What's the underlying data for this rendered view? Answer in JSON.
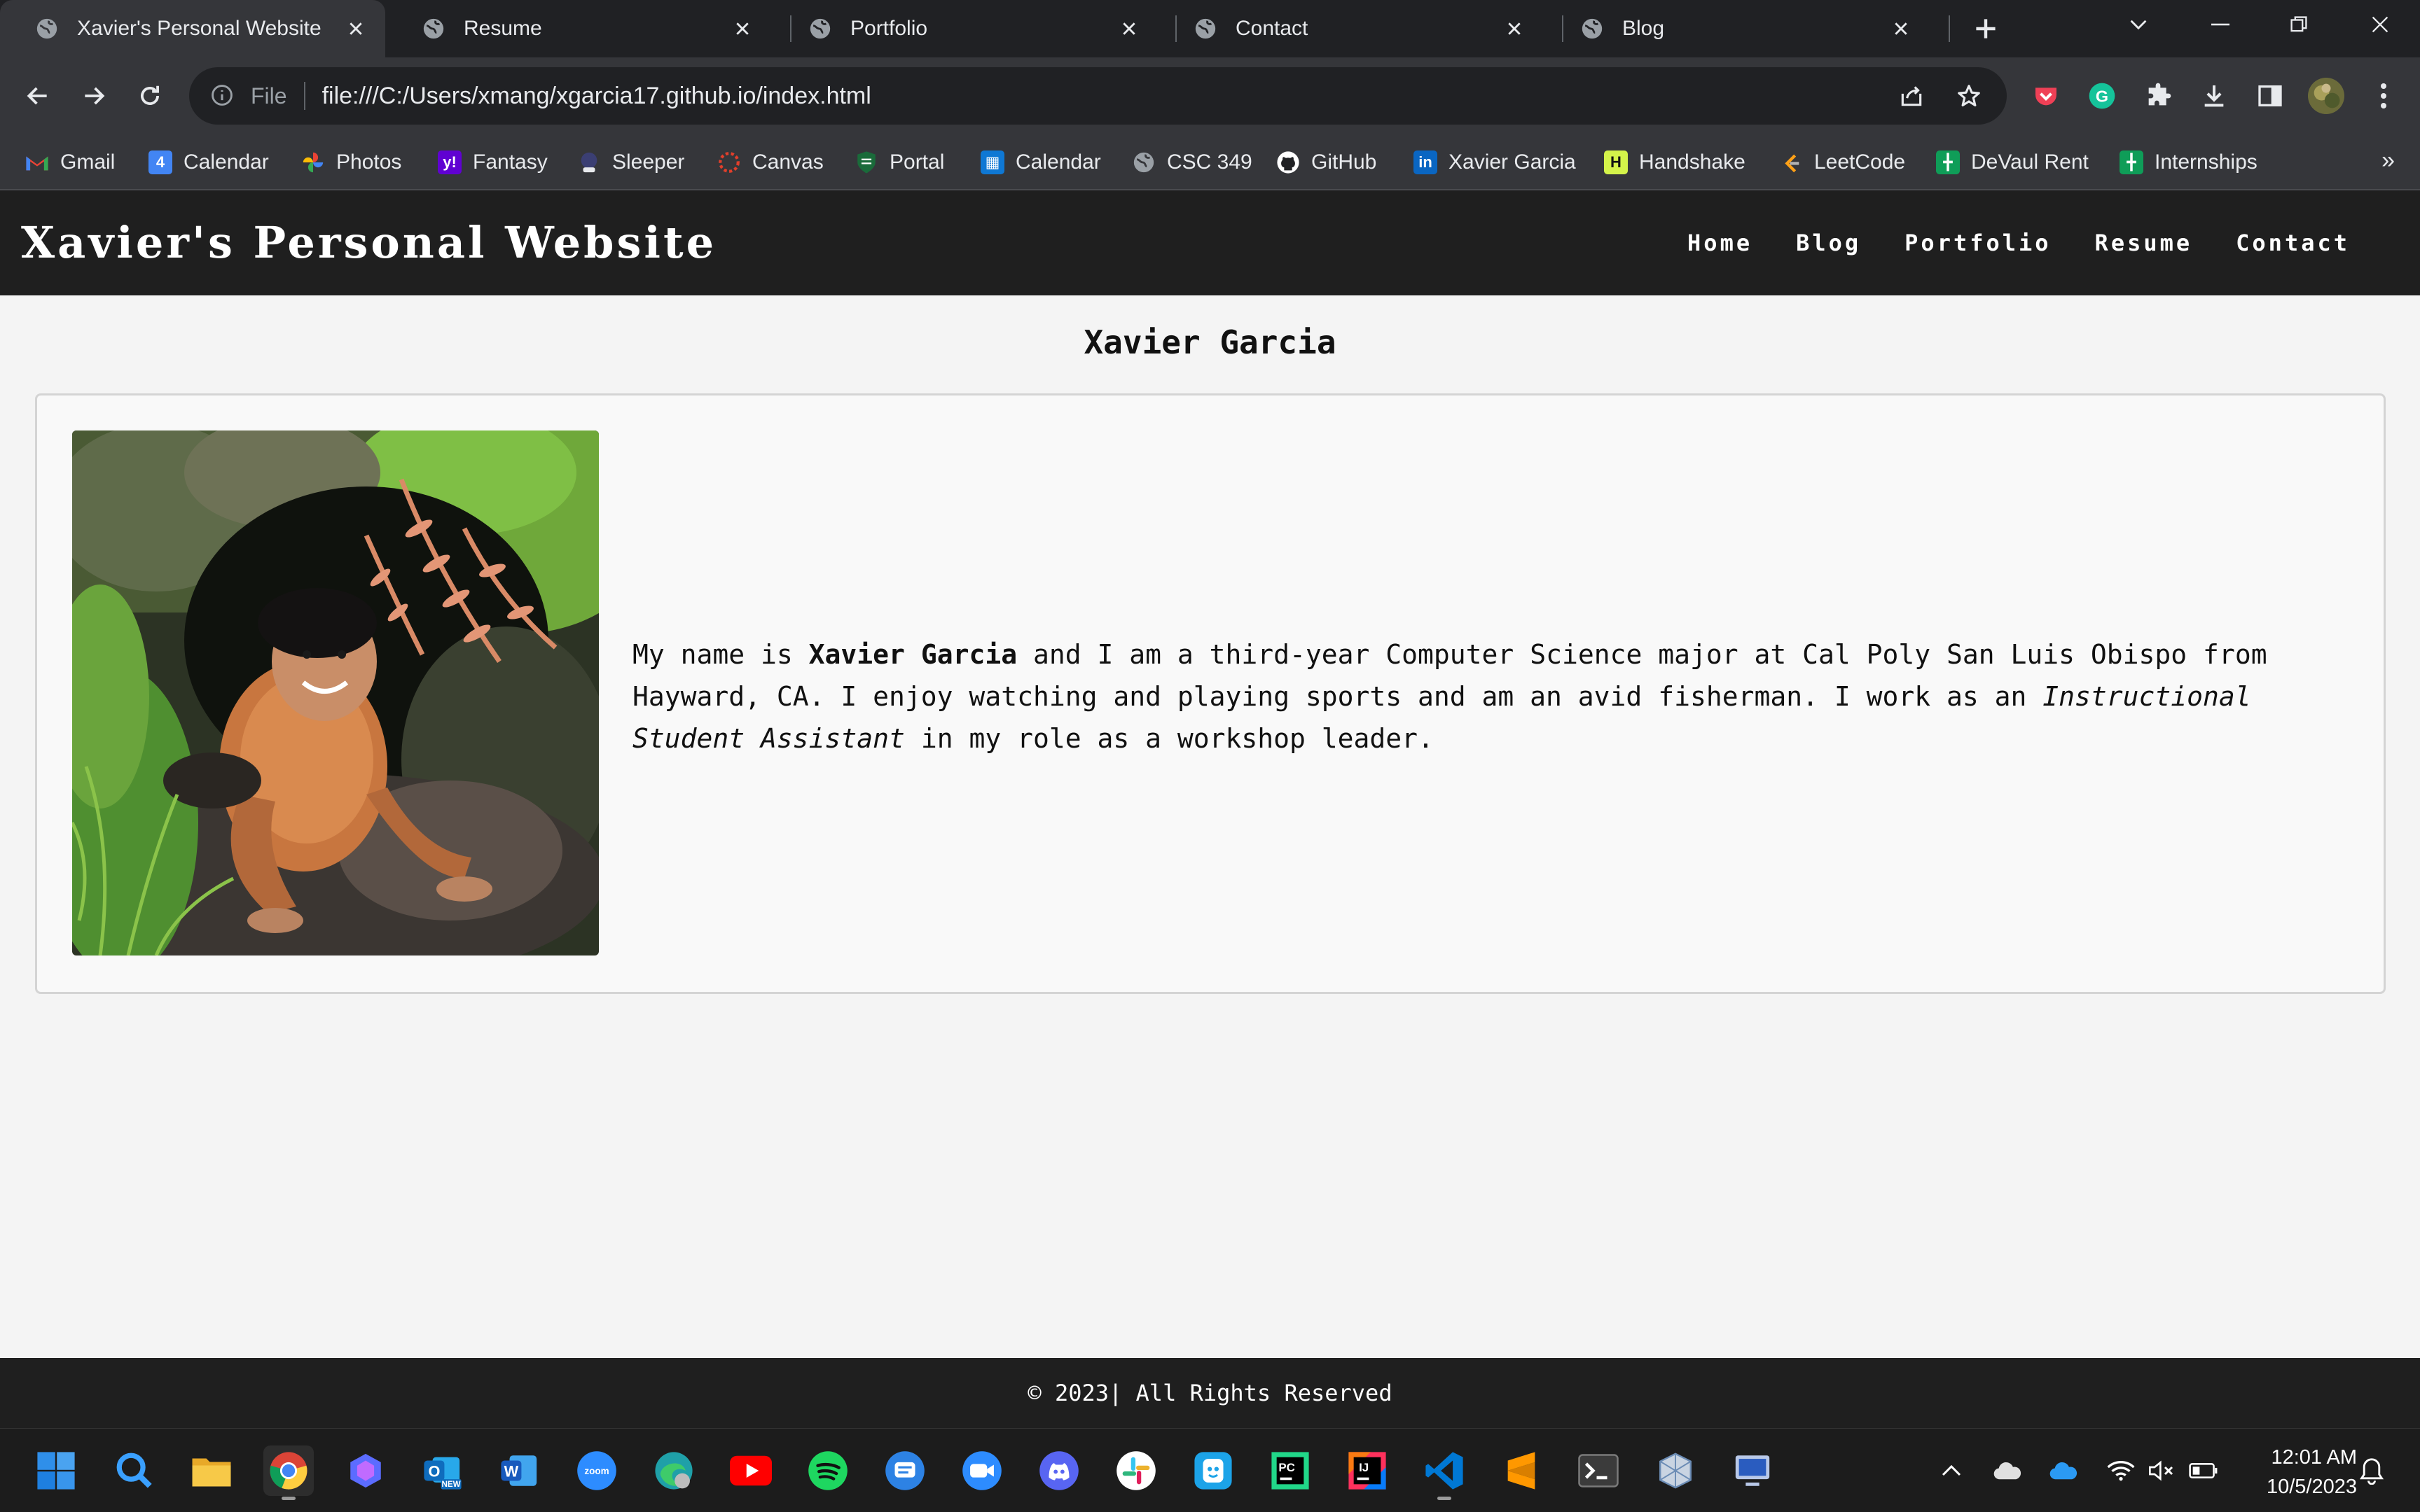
{
  "browser": {
    "tabs": [
      {
        "title": "Xavier's Personal Website",
        "active": true
      },
      {
        "title": "Resume",
        "active": false
      },
      {
        "title": "Portfolio",
        "active": false
      },
      {
        "title": "Contact",
        "active": false
      },
      {
        "title": "Blog",
        "active": false
      }
    ],
    "address": {
      "scheme_label": "File",
      "url": "file:///C:/Users/xmang/xgarcia17.github.io/index.html"
    },
    "bookmarks": [
      {
        "label": "Gmail",
        "icon": "gmail-icon",
        "color": "#ea4335"
      },
      {
        "label": "Calendar",
        "icon": "google-calendar-icon",
        "color": "#4285f4"
      },
      {
        "label": "Photos",
        "icon": "google-photos-icon",
        "color": "#fbbc05"
      },
      {
        "label": "Fantasy",
        "icon": "yahoo-icon",
        "color": "#6001d2"
      },
      {
        "label": "Sleeper",
        "icon": "sleeper-icon",
        "color": "#3b3f73"
      },
      {
        "label": "Canvas",
        "icon": "canvas-icon",
        "color": "#e13f2b"
      },
      {
        "label": "Portal",
        "icon": "shield-portal-icon",
        "color": "#1a6b3a"
      },
      {
        "label": "Calendar",
        "icon": "outlook-calendar-icon",
        "color": "#0f78d4"
      },
      {
        "label": "CSC 349",
        "icon": "globe-icon",
        "color": "#9aa0a6"
      },
      {
        "label": "GitHub",
        "icon": "github-icon",
        "color": "#ffffff"
      },
      {
        "label": "Xavier Garcia",
        "icon": "linkedin-icon",
        "color": "#0a66c2"
      },
      {
        "label": "Handshake",
        "icon": "handshake-icon",
        "color": "#d4f34a"
      },
      {
        "label": "LeetCode",
        "icon": "leetcode-icon",
        "color": "#ffa116"
      },
      {
        "label": "DeVaul Rent",
        "icon": "google-sheets-icon",
        "color": "#0f9d58"
      },
      {
        "label": "Internships",
        "icon": "google-sheets-icon",
        "color": "#0f9d58"
      }
    ],
    "bookmarks_more": "»"
  },
  "site": {
    "title": "Xavier's Personal Website",
    "nav": [
      "Home",
      "Blog",
      "Portfolio",
      "Resume",
      "Contact"
    ],
    "heading": "Xavier Garcia",
    "bio": {
      "part1": "My name is ",
      "name": "Xavier Garcia",
      "part2": " and I am a third-year Computer Science major at Cal Poly San Luis Obispo from Hayward, CA. I enjoy watching and playing sports and am an avid fisherman. I work as an ",
      "role": "Instructional Student Assistant",
      "part3": " in my role as a workshop leader."
    },
    "footer": "© 2023| All Rights Reserved"
  },
  "taskbar": {
    "time": "12:01 AM",
    "date": "10/5/2023",
    "apps": [
      "start-icon",
      "search-icon",
      "file-explorer-icon",
      "chrome-icon",
      "copilot-icon",
      "outlook-icon",
      "word-icon",
      "zoom-icon",
      "edge-icon",
      "youtube-icon",
      "spotify-icon",
      "messages-icon",
      "zoom-meetings-icon",
      "discord-icon",
      "slack-icon",
      "discord-alt-icon",
      "pycharm-icon",
      "intellij-icon",
      "vscode-icon",
      "sublime-icon",
      "terminal-icon",
      "virtualbox-icon",
      "remote-desktop-icon"
    ]
  },
  "colors": {
    "header_bg": "#1f1f1f",
    "page_bg": "#f4f4f4",
    "card_bg": "#f9f9f9",
    "browser_bg": "#35363a"
  }
}
